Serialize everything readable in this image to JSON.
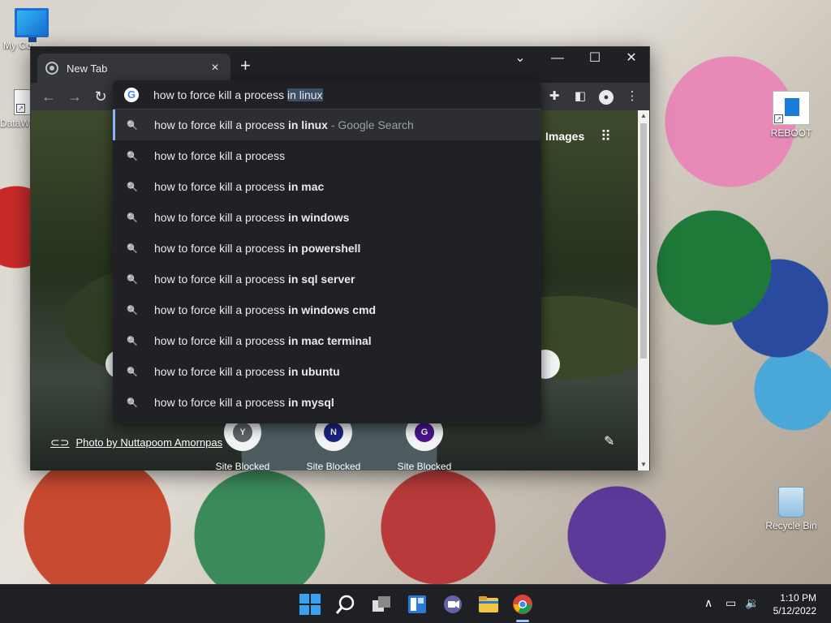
{
  "desktop": {
    "icons": [
      {
        "label": "My Co",
        "icon": "this-pc"
      },
      {
        "label": "DataW",
        "icon": "shortcut"
      },
      {
        "label": "REBOOT",
        "icon": "reboot-shortcut"
      },
      {
        "label": "Recycle Bin",
        "icon": "recycle-bin"
      }
    ]
  },
  "browser": {
    "tab": {
      "title": "New Tab",
      "close_label": "×"
    },
    "new_tab_label": "+",
    "window_controls": {
      "dropdown": "⌄",
      "minimize": "—",
      "maximize": "☐",
      "close": "✕"
    },
    "omnibox": {
      "typed": "how to force kill a process ",
      "autocomplete": "in linux",
      "suggestions": [
        {
          "base": "how to force kill a process ",
          "bold": "in linux",
          "suffix": " - Google Search"
        },
        {
          "base": "how to force kill a process",
          "bold": "",
          "suffix": ""
        },
        {
          "base": "how to force kill a process ",
          "bold": "in mac",
          "suffix": ""
        },
        {
          "base": "how to force kill a process ",
          "bold": "in windows",
          "suffix": ""
        },
        {
          "base": "how to force kill a process ",
          "bold": "in powershell",
          "suffix": ""
        },
        {
          "base": "how to force kill a process ",
          "bold": "in sql server",
          "suffix": ""
        },
        {
          "base": "how to force kill a process ",
          "bold": "in windows cmd",
          "suffix": ""
        },
        {
          "base": "how to force kill a process ",
          "bold": "in mac terminal",
          "suffix": ""
        },
        {
          "base": "how to force kill a process ",
          "bold": "in ubuntu",
          "suffix": ""
        },
        {
          "base": "how to force kill a process ",
          "bold": "in mysql",
          "suffix": ""
        }
      ]
    },
    "page": {
      "images_link": "Images",
      "photo_credit": "Photo by Nuttapoom Amornpas",
      "shortcuts": [
        {
          "letter": "Y",
          "label": "Site Blocked",
          "color": "#5f6368"
        },
        {
          "letter": "N",
          "label": "Site Blocked",
          "color": "#1a237e"
        },
        {
          "letter": "G",
          "label": "Site Blocked",
          "color": "#4a148c"
        }
      ]
    }
  },
  "taskbar": {
    "apps": [
      "start",
      "search",
      "task-view",
      "widgets",
      "teams-chat",
      "file-explorer",
      "chrome"
    ],
    "clock": {
      "time": "1:10 PM",
      "date": "5/12/2022"
    }
  }
}
